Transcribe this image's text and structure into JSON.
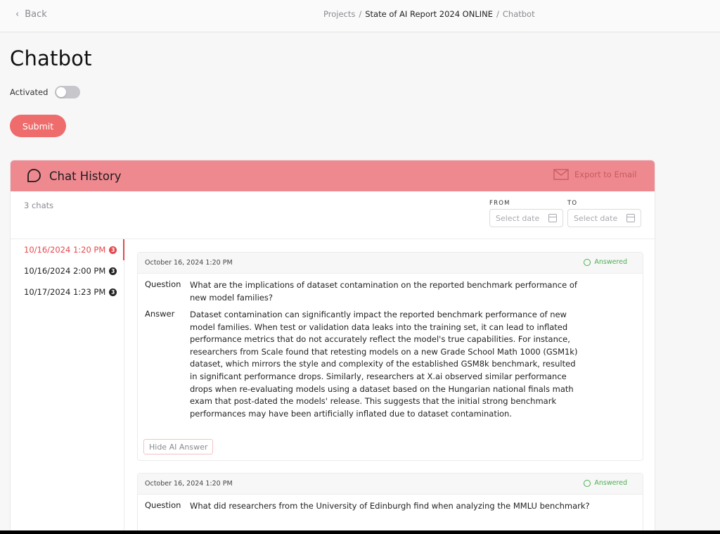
{
  "topbar": {
    "back_label": "Back",
    "breadcrumb": {
      "projects": "Projects",
      "sep1": "/",
      "project": "State of AI Report 2024 ONLINE",
      "sep2": "/",
      "current": "Chatbot"
    }
  },
  "page": {
    "title": "Chatbot",
    "activated_label": "Activated",
    "activated": false,
    "submit_label": "Submit"
  },
  "chat_history": {
    "title": "Chat History",
    "export_label": "Export to Email",
    "count_label": "3 chats",
    "from_label": "FROM",
    "to_label": "TO",
    "date_placeholder": "Select date",
    "sessions": [
      {
        "label": "10/16/2024 1:20 PM",
        "count": "3",
        "active": true
      },
      {
        "label": "10/16/2024 2:00 PM",
        "count": "3",
        "active": false
      },
      {
        "label": "10/17/2024 1:23 PM",
        "count": "3",
        "active": false
      }
    ],
    "conversations": [
      {
        "date": "October 16, 2024 1:20 PM",
        "status": "Answered",
        "question_label": "Question",
        "question": "What are the implications of dataset contamination on the reported benchmark performance of new model families?",
        "answer_label": "Answer",
        "answer": "Dataset contamination can significantly impact the reported benchmark performance of new model families. When test or validation data leaks into the training set, it can lead to inflated performance metrics that do not accurately reflect the model's true capabilities. For instance, researchers from Scale found that retesting models on a new Grade School Math 1000 (GSM1k) dataset, which mirrors the style and complexity of the established GSM8k benchmark, resulted in significant performance drops. Similarly, researchers at X.ai observed similar performance drops when re-evaluating models using a dataset based on the Hungarian national finals math exam that post-dated the models' release. This suggests that the initial strong benchmark performances may have been artificially inflated due to dataset contamination.",
        "hide_label": "Hide AI Answer"
      },
      {
        "date": "October 16, 2024 1:20 PM",
        "status": "Answered",
        "question_label": "Question",
        "question": "What did researchers from the University of Edinburgh find when analyzing the MMLU benchmark?"
      }
    ]
  },
  "colors": {
    "accent": "#ee6c6c",
    "header": "#ef8990",
    "answered": "#4caf50",
    "active": "#e5484d"
  }
}
